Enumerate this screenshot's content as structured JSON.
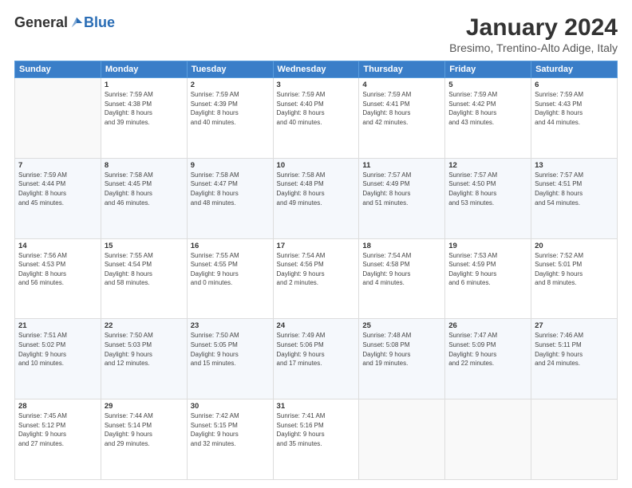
{
  "logo": {
    "general": "General",
    "blue": "Blue"
  },
  "title": "January 2024",
  "location": "Bresimo, Trentino-Alto Adige, Italy",
  "days_header": [
    "Sunday",
    "Monday",
    "Tuesday",
    "Wednesday",
    "Thursday",
    "Friday",
    "Saturday"
  ],
  "weeks": [
    [
      {
        "day": "",
        "info": ""
      },
      {
        "day": "1",
        "info": "Sunrise: 7:59 AM\nSunset: 4:38 PM\nDaylight: 8 hours\nand 39 minutes."
      },
      {
        "day": "2",
        "info": "Sunrise: 7:59 AM\nSunset: 4:39 PM\nDaylight: 8 hours\nand 40 minutes."
      },
      {
        "day": "3",
        "info": "Sunrise: 7:59 AM\nSunset: 4:40 PM\nDaylight: 8 hours\nand 40 minutes."
      },
      {
        "day": "4",
        "info": "Sunrise: 7:59 AM\nSunset: 4:41 PM\nDaylight: 8 hours\nand 42 minutes."
      },
      {
        "day": "5",
        "info": "Sunrise: 7:59 AM\nSunset: 4:42 PM\nDaylight: 8 hours\nand 43 minutes."
      },
      {
        "day": "6",
        "info": "Sunrise: 7:59 AM\nSunset: 4:43 PM\nDaylight: 8 hours\nand 44 minutes."
      }
    ],
    [
      {
        "day": "7",
        "info": "Sunrise: 7:59 AM\nSunset: 4:44 PM\nDaylight: 8 hours\nand 45 minutes."
      },
      {
        "day": "8",
        "info": "Sunrise: 7:58 AM\nSunset: 4:45 PM\nDaylight: 8 hours\nand 46 minutes."
      },
      {
        "day": "9",
        "info": "Sunrise: 7:58 AM\nSunset: 4:47 PM\nDaylight: 8 hours\nand 48 minutes."
      },
      {
        "day": "10",
        "info": "Sunrise: 7:58 AM\nSunset: 4:48 PM\nDaylight: 8 hours\nand 49 minutes."
      },
      {
        "day": "11",
        "info": "Sunrise: 7:57 AM\nSunset: 4:49 PM\nDaylight: 8 hours\nand 51 minutes."
      },
      {
        "day": "12",
        "info": "Sunrise: 7:57 AM\nSunset: 4:50 PM\nDaylight: 8 hours\nand 53 minutes."
      },
      {
        "day": "13",
        "info": "Sunrise: 7:57 AM\nSunset: 4:51 PM\nDaylight: 8 hours\nand 54 minutes."
      }
    ],
    [
      {
        "day": "14",
        "info": "Sunrise: 7:56 AM\nSunset: 4:53 PM\nDaylight: 8 hours\nand 56 minutes."
      },
      {
        "day": "15",
        "info": "Sunrise: 7:55 AM\nSunset: 4:54 PM\nDaylight: 8 hours\nand 58 minutes."
      },
      {
        "day": "16",
        "info": "Sunrise: 7:55 AM\nSunset: 4:55 PM\nDaylight: 9 hours\nand 0 minutes."
      },
      {
        "day": "17",
        "info": "Sunrise: 7:54 AM\nSunset: 4:56 PM\nDaylight: 9 hours\nand 2 minutes."
      },
      {
        "day": "18",
        "info": "Sunrise: 7:54 AM\nSunset: 4:58 PM\nDaylight: 9 hours\nand 4 minutes."
      },
      {
        "day": "19",
        "info": "Sunrise: 7:53 AM\nSunset: 4:59 PM\nDaylight: 9 hours\nand 6 minutes."
      },
      {
        "day": "20",
        "info": "Sunrise: 7:52 AM\nSunset: 5:01 PM\nDaylight: 9 hours\nand 8 minutes."
      }
    ],
    [
      {
        "day": "21",
        "info": "Sunrise: 7:51 AM\nSunset: 5:02 PM\nDaylight: 9 hours\nand 10 minutes."
      },
      {
        "day": "22",
        "info": "Sunrise: 7:50 AM\nSunset: 5:03 PM\nDaylight: 9 hours\nand 12 minutes."
      },
      {
        "day": "23",
        "info": "Sunrise: 7:50 AM\nSunset: 5:05 PM\nDaylight: 9 hours\nand 15 minutes."
      },
      {
        "day": "24",
        "info": "Sunrise: 7:49 AM\nSunset: 5:06 PM\nDaylight: 9 hours\nand 17 minutes."
      },
      {
        "day": "25",
        "info": "Sunrise: 7:48 AM\nSunset: 5:08 PM\nDaylight: 9 hours\nand 19 minutes."
      },
      {
        "day": "26",
        "info": "Sunrise: 7:47 AM\nSunset: 5:09 PM\nDaylight: 9 hours\nand 22 minutes."
      },
      {
        "day": "27",
        "info": "Sunrise: 7:46 AM\nSunset: 5:11 PM\nDaylight: 9 hours\nand 24 minutes."
      }
    ],
    [
      {
        "day": "28",
        "info": "Sunrise: 7:45 AM\nSunset: 5:12 PM\nDaylight: 9 hours\nand 27 minutes."
      },
      {
        "day": "29",
        "info": "Sunrise: 7:44 AM\nSunset: 5:14 PM\nDaylight: 9 hours\nand 29 minutes."
      },
      {
        "day": "30",
        "info": "Sunrise: 7:42 AM\nSunset: 5:15 PM\nDaylight: 9 hours\nand 32 minutes."
      },
      {
        "day": "31",
        "info": "Sunrise: 7:41 AM\nSunset: 5:16 PM\nDaylight: 9 hours\nand 35 minutes."
      },
      {
        "day": "",
        "info": ""
      },
      {
        "day": "",
        "info": ""
      },
      {
        "day": "",
        "info": ""
      }
    ]
  ]
}
